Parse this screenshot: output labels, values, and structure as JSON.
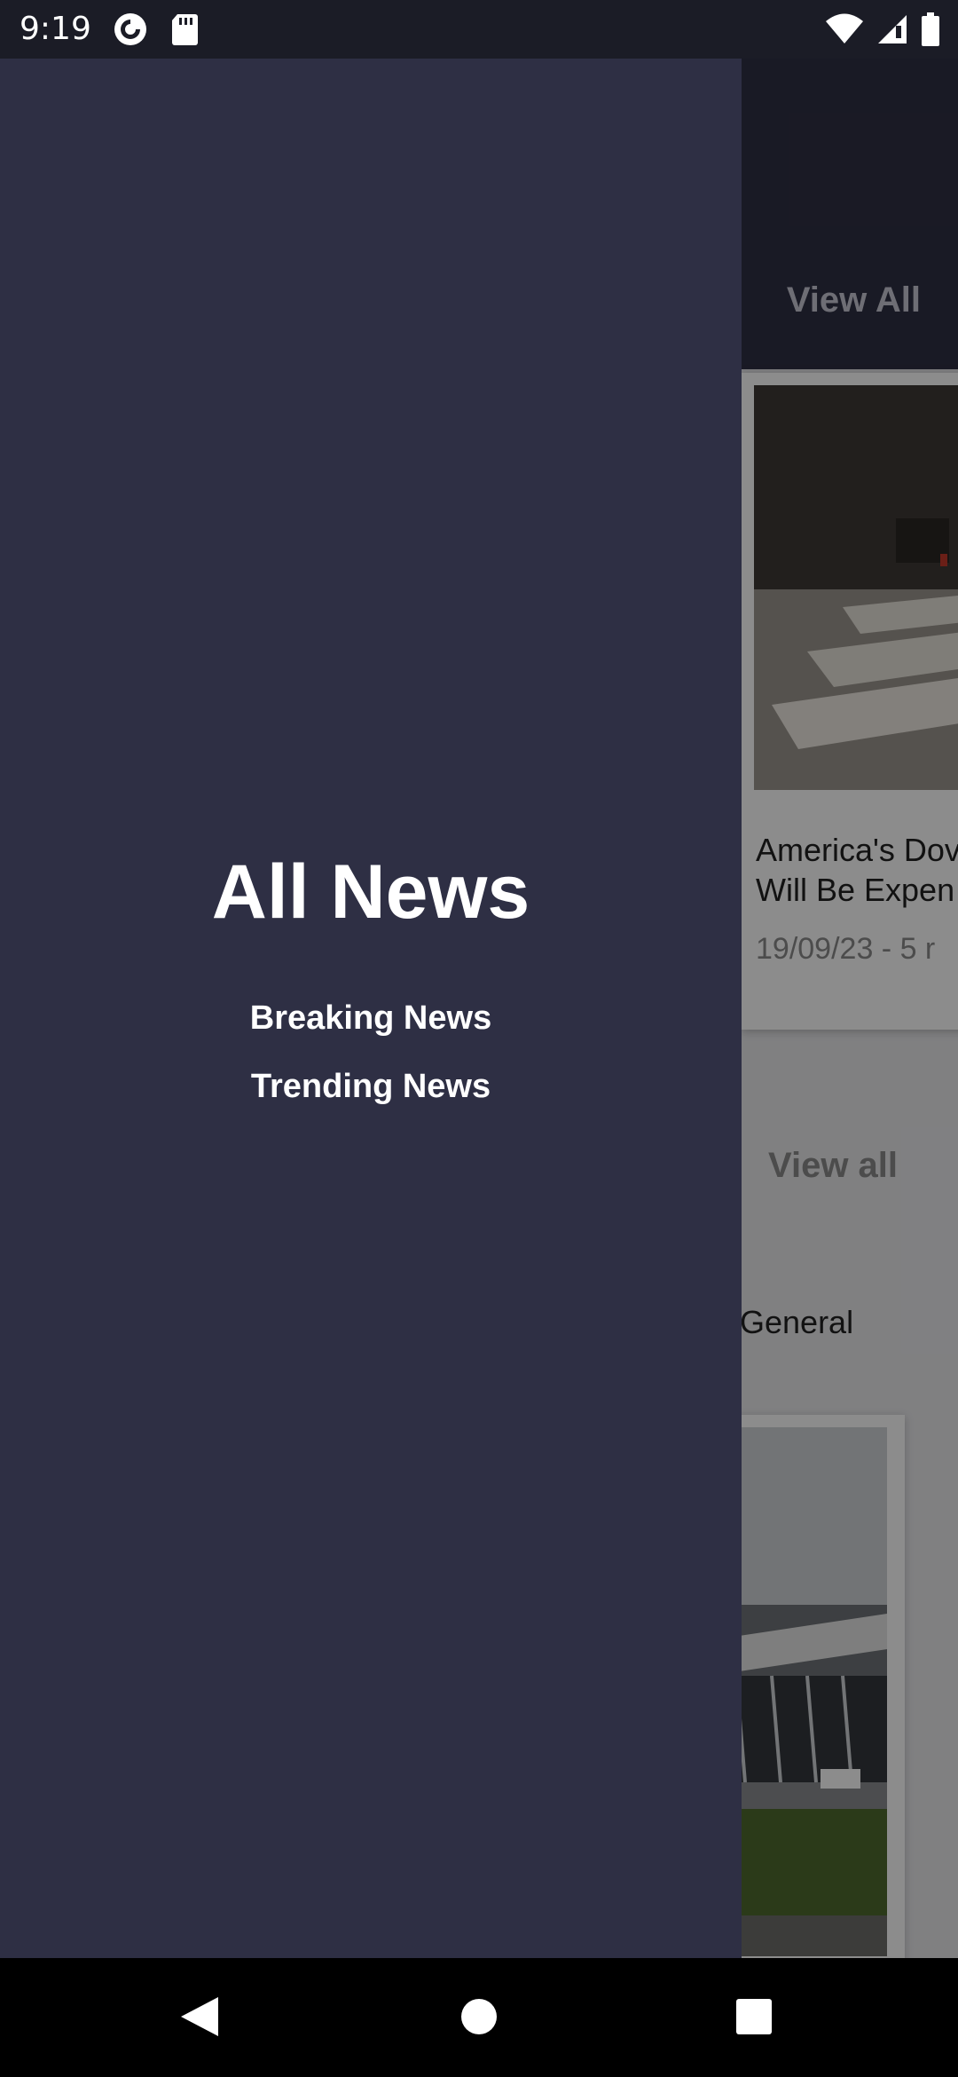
{
  "status_bar": {
    "time": "9:19",
    "icons": [
      "pocket-casts-icon",
      "sd-card-icon",
      "wifi-icon",
      "signal-icon",
      "battery-icon"
    ]
  },
  "background": {
    "top_view_all": "View All",
    "featured_card": {
      "title_line1": "America's Dov",
      "title_line2": "Will Be Expen",
      "date": "19/09/23",
      "meta_suffix": " - 5 r"
    },
    "mid_view_all": "View all",
    "category_label": "General"
  },
  "drawer": {
    "title": "All News",
    "items": [
      {
        "label": "Breaking News"
      },
      {
        "label": "Trending News"
      }
    ]
  },
  "nav_bar": {
    "buttons": [
      "back",
      "home",
      "recents"
    ]
  },
  "colors": {
    "drawer_bg": "#2e2f44",
    "status_bar_bg": "#1b1c26",
    "text_primary": "#ffffff"
  }
}
